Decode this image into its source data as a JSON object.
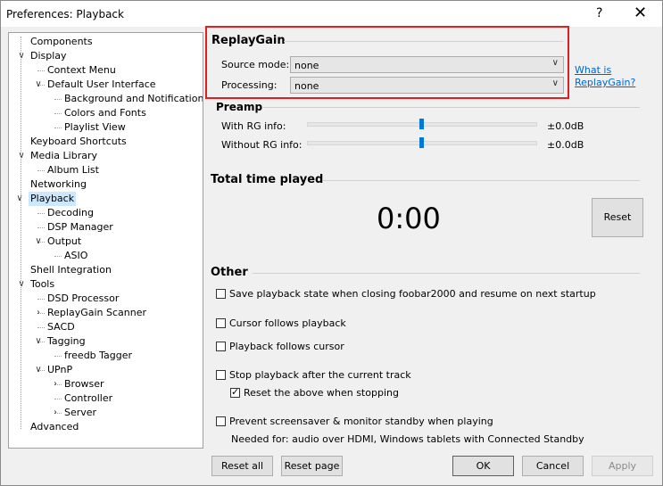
{
  "window": {
    "title": "Preferences: Playback",
    "help": "?",
    "close": "✕"
  },
  "tree": [
    {
      "label": "Components",
      "level": 0
    },
    {
      "label": "Display",
      "level": 0,
      "exp": "v"
    },
    {
      "label": "Context Menu",
      "level": 1
    },
    {
      "label": "Default User Interface",
      "level": 1,
      "exp": "v"
    },
    {
      "label": "Background and Notifications",
      "level": 2
    },
    {
      "label": "Colors and Fonts",
      "level": 2
    },
    {
      "label": "Playlist View",
      "level": 2
    },
    {
      "label": "Keyboard Shortcuts",
      "level": 0
    },
    {
      "label": "Media Library",
      "level": 0,
      "exp": "v"
    },
    {
      "label": "Album List",
      "level": 1
    },
    {
      "label": "Networking",
      "level": 0
    },
    {
      "label": "Playback",
      "level": 0,
      "exp": "v",
      "selected": true
    },
    {
      "label": "Decoding",
      "level": 1
    },
    {
      "label": "DSP Manager",
      "level": 1
    },
    {
      "label": "Output",
      "level": 1,
      "exp": "v"
    },
    {
      "label": "ASIO",
      "level": 2
    },
    {
      "label": "Shell Integration",
      "level": 0
    },
    {
      "label": "Tools",
      "level": 0,
      "exp": "v"
    },
    {
      "label": "DSD Processor",
      "level": 1
    },
    {
      "label": "ReplayGain Scanner",
      "level": 1,
      "exp": ">"
    },
    {
      "label": "SACD",
      "level": 1
    },
    {
      "label": "Tagging",
      "level": 1,
      "exp": "v"
    },
    {
      "label": "freedb Tagger",
      "level": 2
    },
    {
      "label": "UPnP",
      "level": 1,
      "exp": "v"
    },
    {
      "label": "Browser",
      "level": 2,
      "exp": ">"
    },
    {
      "label": "Controller",
      "level": 2
    },
    {
      "label": "Server",
      "level": 2,
      "exp": ">"
    },
    {
      "label": "Advanced",
      "level": 0
    }
  ],
  "replaygain": {
    "heading": "ReplayGain",
    "source_label": "Source mode:",
    "source_value": "none",
    "processing_label": "Processing:",
    "processing_value": "none",
    "link_line1": "What is",
    "link_line2": "ReplayGain?"
  },
  "preamp": {
    "heading": "Preamp",
    "with_label": "With RG info:",
    "with_value": "±0.0dB",
    "with_level": 0.5,
    "without_label": "Without RG info:",
    "without_value": "±0.0dB",
    "without_level": 0.5
  },
  "total_time": {
    "heading": "Total time played",
    "value": "0:00",
    "reset_label": "Reset"
  },
  "other": {
    "heading": "Other",
    "options": [
      {
        "label": "Save playback state when closing foobar2000 and resume on next startup",
        "checked": false
      },
      {
        "label": "Cursor follows playback",
        "checked": false
      },
      {
        "label": "Playback follows cursor",
        "checked": false
      },
      {
        "label": "Stop playback after the current track",
        "checked": false
      },
      {
        "label": "Reset the above when stopping",
        "checked": true
      },
      {
        "label": "Prevent screensaver & monitor standby when playing",
        "checked": false
      }
    ],
    "note": "Needed for: audio over HDMI, Windows tablets with Connected Standby"
  },
  "footer": {
    "reset_all": "Reset all",
    "reset_page": "Reset page",
    "ok": "OK",
    "cancel": "Cancel",
    "apply": "Apply"
  },
  "colors": {
    "accent": "#0078d7",
    "highlight_box": "#e02020",
    "selection": "#cce8ff"
  }
}
